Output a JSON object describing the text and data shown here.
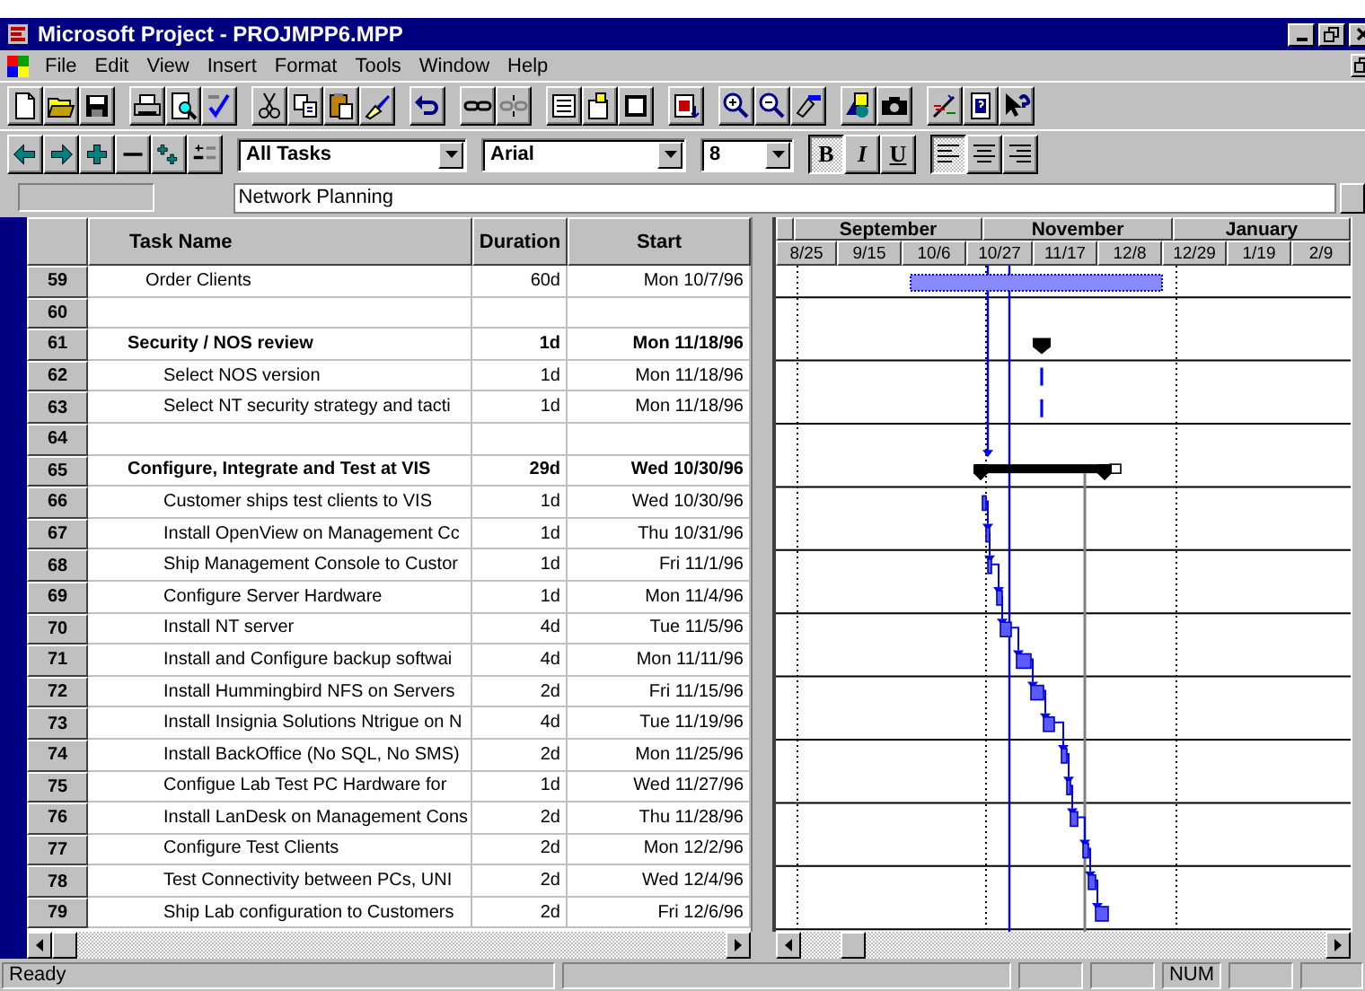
{
  "window": {
    "title": "Microsoft Project - PROJMPP6.MPP"
  },
  "menu": [
    "File",
    "Edit",
    "View",
    "Insert",
    "Format",
    "Tools",
    "Window",
    "Help"
  ],
  "formatting": {
    "filter": "All Tasks",
    "font": "Arial",
    "size": "8",
    "styles": [
      {
        "label": "B",
        "selected": true
      },
      {
        "label": "I",
        "selected": false
      },
      {
        "label": "U",
        "selected": false
      }
    ],
    "alignments": [
      {
        "kind": "left",
        "selected": true
      },
      {
        "kind": "center",
        "selected": false
      },
      {
        "kind": "right",
        "selected": false
      }
    ]
  },
  "entry_bar": {
    "value": "Network Planning"
  },
  "table": {
    "columns": [
      "Task Name",
      "Duration",
      "Start"
    ],
    "rows": [
      {
        "id": "59",
        "kind": "task",
        "name": "Order Clients",
        "duration": "60d",
        "start": "Mon 10/7/96"
      },
      {
        "id": "60",
        "kind": "blank"
      },
      {
        "id": "61",
        "kind": "summary",
        "name": "Security / NOS review",
        "duration": "1d",
        "start": "Mon 11/18/96",
        "children": [
          {
            "id": "62",
            "kind": "task",
            "name": "Select NOS version",
            "duration": "1d",
            "start": "Mon 11/18/96"
          },
          {
            "id": "63",
            "kind": "task",
            "name": "Select NT security strategy and tacti",
            "duration": "1d",
            "start": "Mon 11/18/96"
          }
        ]
      },
      {
        "id": "64",
        "kind": "blank"
      },
      {
        "id": "65",
        "kind": "summary",
        "name": "Configure, Integrate and Test at VIS",
        "duration": "29d",
        "start": "Wed 10/30/96",
        "children": [
          {
            "id": "66",
            "kind": "task",
            "name": "Customer ships test clients to VIS",
            "duration": "1d",
            "start": "Wed 10/30/96"
          },
          {
            "id": "67",
            "kind": "task",
            "name": "Install OpenView on Management Cc",
            "duration": "1d",
            "start": "Thu 10/31/96"
          },
          {
            "id": "68",
            "kind": "task",
            "name": "Ship Management Console to Custor",
            "duration": "1d",
            "start": "Fri 11/1/96"
          },
          {
            "id": "69",
            "kind": "task",
            "name": "Configure Server Hardware",
            "duration": "1d",
            "start": "Mon 11/4/96"
          },
          {
            "id": "70",
            "kind": "task",
            "name": "Install NT server",
            "duration": "4d",
            "start": "Tue 11/5/96"
          },
          {
            "id": "71",
            "kind": "task",
            "name": "Install and Configure backup softwai",
            "duration": "4d",
            "start": "Mon 11/11/96"
          },
          {
            "id": "72",
            "kind": "task",
            "name": "Install Hummingbird NFS on Servers",
            "duration": "2d",
            "start": "Fri 11/15/96"
          },
          {
            "id": "73",
            "kind": "task",
            "name": "Install Insignia Solutions Ntrigue on N",
            "duration": "4d",
            "start": "Tue 11/19/96"
          },
          {
            "id": "74",
            "kind": "task",
            "name": "Install BackOffice (No SQL, No SMS)",
            "duration": "2d",
            "start": "Mon 11/25/96"
          },
          {
            "id": "75",
            "kind": "task",
            "name": "Configue Lab Test PC Hardware for",
            "duration": "1d",
            "start": "Wed 11/27/96"
          },
          {
            "id": "76",
            "kind": "task",
            "name": "Install LanDesk on Management Cons",
            "duration": "2d",
            "start": "Thu 11/28/96"
          },
          {
            "id": "77",
            "kind": "task",
            "name": "Configure Test Clients",
            "duration": "2d",
            "start": "Mon 12/2/96"
          },
          {
            "id": "78",
            "kind": "task",
            "name": "Test Connectivity between PCs, UNI",
            "duration": "2d",
            "start": "Wed 12/4/96"
          },
          {
            "id": "79",
            "kind": "task",
            "name": "Ship Lab configuration to Customers",
            "duration": "2d",
            "start": "Fri 12/6/96"
          }
        ]
      }
    ]
  },
  "timeline": {
    "months": [
      "September",
      "November",
      "January"
    ],
    "weeks": [
      "8/25",
      "9/15",
      "10/6",
      "10/27",
      "11/17",
      "12/8",
      "12/29",
      "1/19",
      "2/9"
    ]
  },
  "status_bar": {
    "message": "Ready",
    "indicators": [
      "NUM"
    ]
  }
}
